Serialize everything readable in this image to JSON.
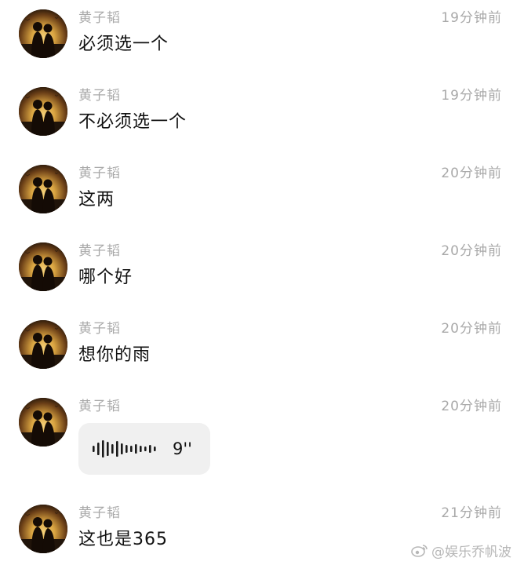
{
  "conversation": {
    "messages": [
      {
        "sender": "黄子韬",
        "time": "19分钟前",
        "text": "必须选一个"
      },
      {
        "sender": "黄子韬",
        "time": "19分钟前",
        "text": "不必须选一个"
      },
      {
        "sender": "黄子韬",
        "time": "20分钟前",
        "text": "这两"
      },
      {
        "sender": "黄子韬",
        "time": "20分钟前",
        "text": "哪个好"
      },
      {
        "sender": "黄子韬",
        "time": "20分钟前",
        "text": "想你的雨"
      },
      {
        "sender": "黄子韬",
        "time": "20分钟前",
        "voice_duration": "9''"
      },
      {
        "sender": "黄子韬",
        "time": "21分钟前",
        "text": "这也是365"
      }
    ]
  },
  "watermark": {
    "text": "@娱乐乔帆波",
    "icon": "weibo-logo-icon"
  },
  "colors": {
    "meta_text": "#a9a9a9",
    "message_text": "#111111",
    "voice_bubble": "#f0f0f0",
    "avatar_sunset": "#d9a441"
  }
}
